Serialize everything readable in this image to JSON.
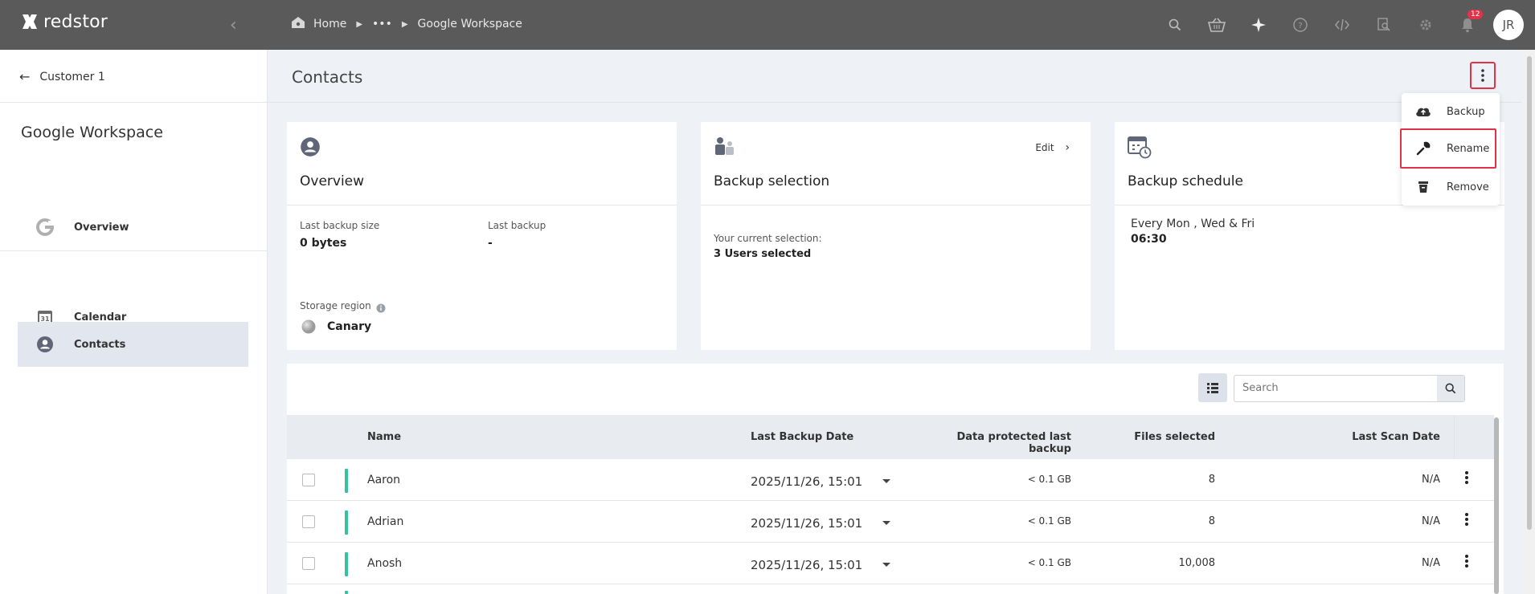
{
  "app": {
    "brand": "redstor",
    "user_initials": "JR",
    "notification_count": "12"
  },
  "breadcrumb": {
    "home": "Home",
    "ellipsis": "•••",
    "current": "Google Workspace"
  },
  "sidebar": {
    "back_label": "Customer 1",
    "title": "Google Workspace",
    "items": [
      {
        "label": "Overview",
        "icon": "google-icon"
      },
      {
        "label": "Calendar",
        "icon": "calendar-icon"
      },
      {
        "label": "Contacts",
        "icon": "contact-icon",
        "active": true
      }
    ]
  },
  "page": {
    "title": "Contacts"
  },
  "menu": {
    "items": [
      {
        "label": "Backup"
      },
      {
        "label": "Rename"
      },
      {
        "label": "Remove"
      }
    ]
  },
  "cards": {
    "overview": {
      "title": "Overview",
      "last_backup_size_label": "Last backup size",
      "last_backup_size": "0 bytes",
      "last_backup_label": "Last backup",
      "last_backup": "-",
      "storage_region_label": "Storage region",
      "storage_region": "Canary"
    },
    "selection": {
      "title": "Backup selection",
      "edit_label": "Edit",
      "current_label": "Your current selection:",
      "current_value": "3 Users selected"
    },
    "schedule": {
      "title": "Backup schedule",
      "days": "Every Mon , Wed & Fri",
      "time": "06:30"
    }
  },
  "table": {
    "search_placeholder": "Search",
    "columns": [
      "Name",
      "Last Backup Date",
      "Data protected last backup",
      "Files selected",
      "Last Scan Date"
    ],
    "rows": [
      {
        "name": "Aaron",
        "date": "2025/11/26, 15:01",
        "data": "< 0.1 GB",
        "files": "8",
        "scan": "N/A"
      },
      {
        "name": "Adrian",
        "date": "2025/11/26, 15:01",
        "data": "< 0.1 GB",
        "files": "8",
        "scan": "N/A"
      },
      {
        "name": "Anosh",
        "date": "2025/11/26, 15:01",
        "data": "< 0.1 GB",
        "files": "10,008",
        "scan": "N/A"
      }
    ]
  },
  "colors": {
    "topbar": "#5a5a5a",
    "accent_red": "#e0334a",
    "status_green": "#2ec5a0"
  }
}
